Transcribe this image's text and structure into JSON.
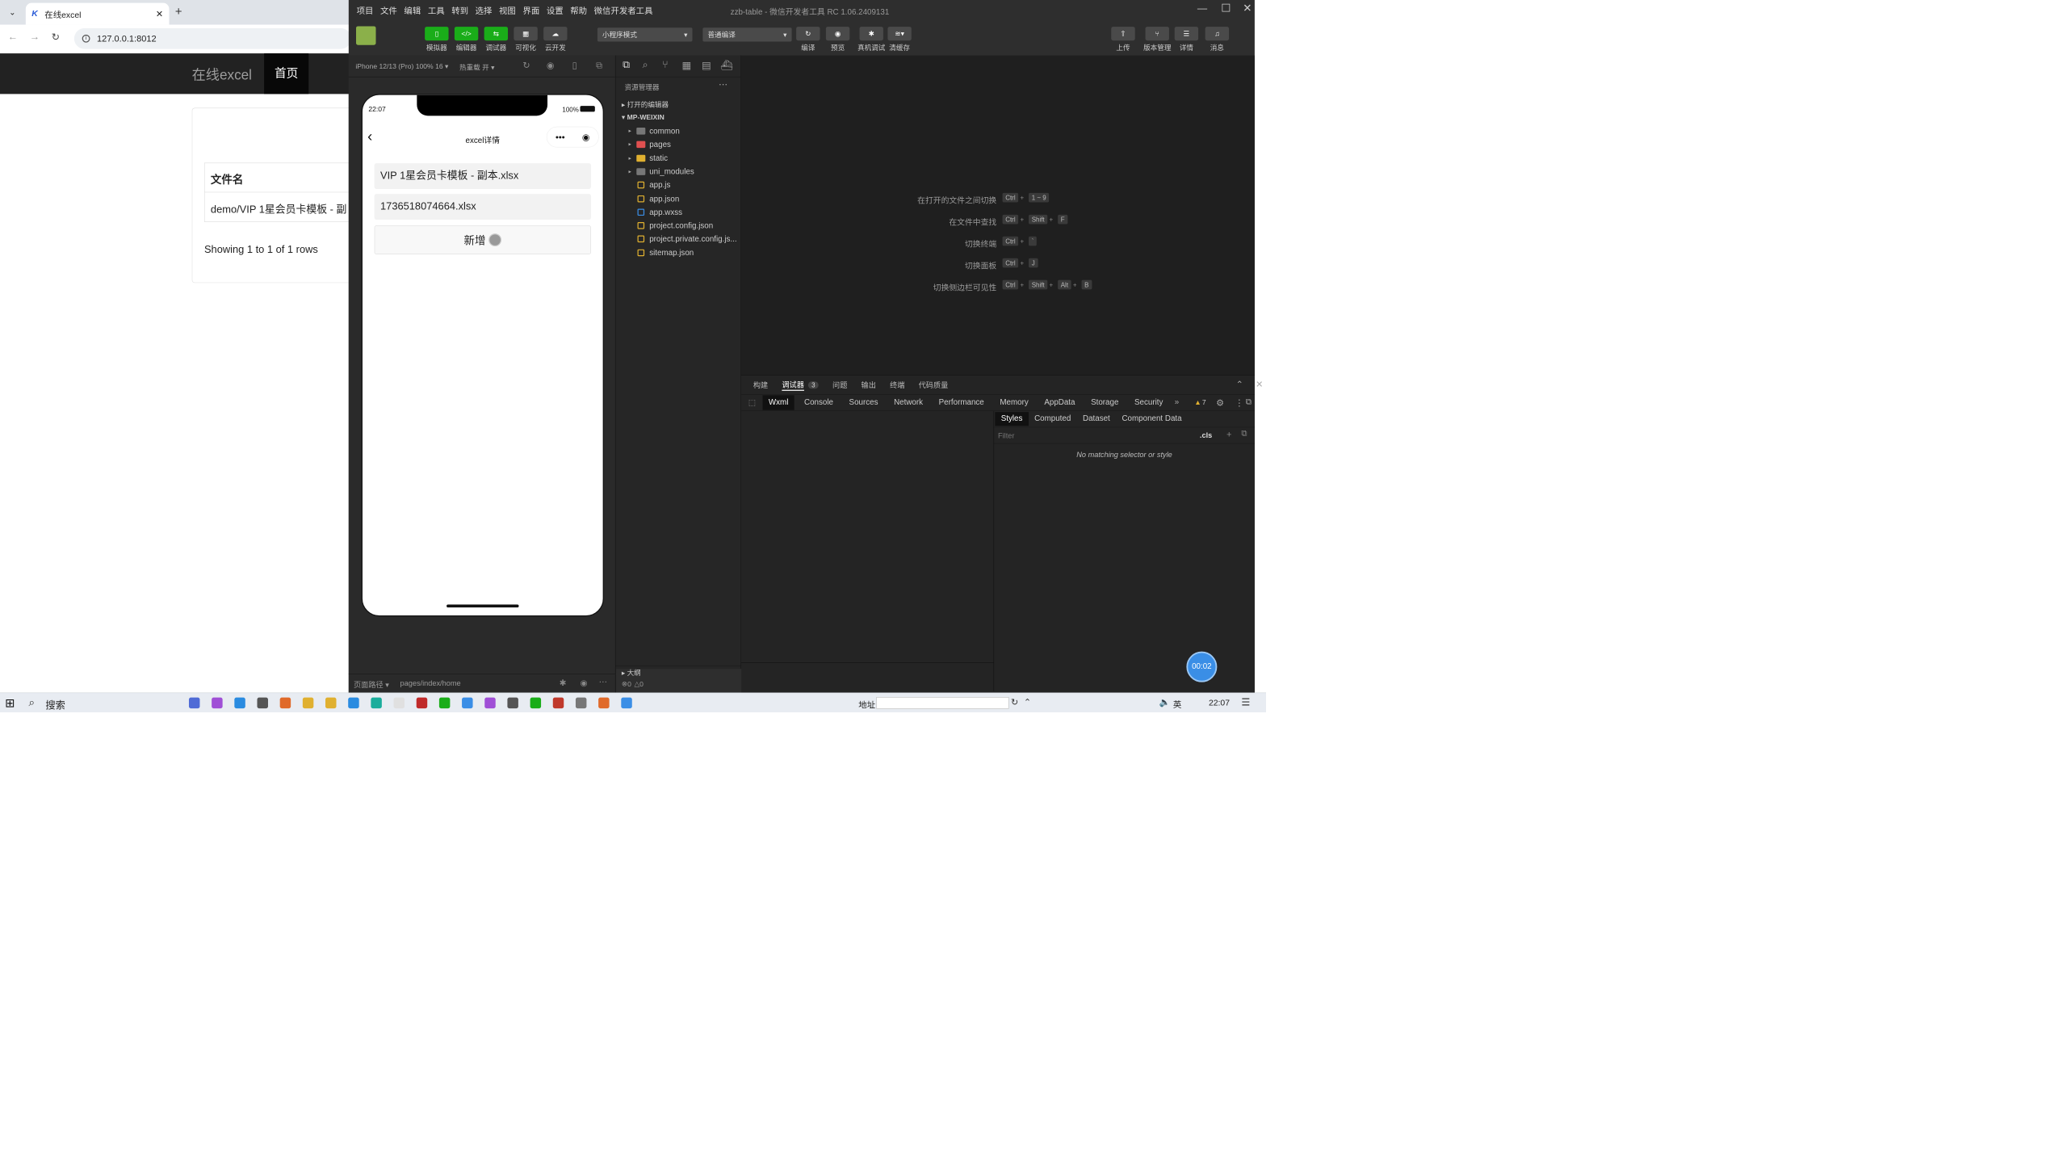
{
  "browser": {
    "tab_title": "在线excel",
    "url": "127.0.0.1:8012"
  },
  "site": {
    "brand": "在线excel",
    "nav_home": "首页",
    "table_header": "文件名",
    "row1": "demo/VIP 1星会员卡模板 - 副",
    "pagination": "Showing 1 to 1 of 1 rows"
  },
  "devtools": {
    "title": "zzb-table - 微信开发者工具 RC 1.06.2409131",
    "menu": [
      "项目",
      "文件",
      "编辑",
      "工具",
      "转到",
      "选择",
      "视图",
      "界面",
      "设置",
      "帮助",
      "微信开发者工具"
    ],
    "toolbar": {
      "simulator": "模拟器",
      "editor": "编辑器",
      "debugger": "调试器",
      "visual": "可视化",
      "cloud": "云开发",
      "mode": "小程序模式",
      "compile_mode": "普通编译",
      "compile": "编译",
      "preview": "预览",
      "real_debug": "真机调试",
      "clear_cache": "清缓存",
      "upload": "上传",
      "version": "版本管理",
      "details": "详情",
      "messages": "消息"
    },
    "device_label": "iPhone 12/13 (Pro) 100% 16 ▾",
    "hot_reload": "热重载 开 ▾",
    "phone": {
      "time": "22:07",
      "battery": "100%",
      "page_title": "excel详情",
      "file1": "VIP 1星会员卡模板 - 副本.xlsx",
      "file2": "1736518074664.xlsx",
      "add_button": "新增"
    },
    "status_bar": {
      "page_path_label": "页面路径 ▾",
      "page_path": "pages/index/home"
    },
    "explorer": {
      "title": "资源管理器",
      "open_editors": "打开的编辑器",
      "project": "MP-WEIXIN",
      "items": [
        {
          "name": "common",
          "type": "folder",
          "color": "#777"
        },
        {
          "name": "pages",
          "type": "folder",
          "color": "#e05050"
        },
        {
          "name": "static",
          "type": "folder",
          "color": "#e0b030"
        },
        {
          "name": "uni_modules",
          "type": "folder",
          "color": "#777"
        },
        {
          "name": "app.js",
          "type": "file",
          "color": "#e0b030"
        },
        {
          "name": "app.json",
          "type": "file",
          "color": "#e0b030"
        },
        {
          "name": "app.wxss",
          "type": "file",
          "color": "#3a8ee6"
        },
        {
          "name": "project.config.json",
          "type": "file",
          "color": "#e0b030"
        },
        {
          "name": "project.private.config.js...",
          "type": "file",
          "color": "#e0b030"
        },
        {
          "name": "sitemap.json",
          "type": "file",
          "color": "#e0b030"
        }
      ],
      "outline": "大纲",
      "errors": "0",
      "warnings": "0"
    },
    "shortcuts": [
      {
        "label": "在打开的文件之间切换",
        "keys": [
          "Ctrl",
          "1 ~ 9"
        ]
      },
      {
        "label": "在文件中查找",
        "keys": [
          "Ctrl",
          "Shift",
          "F"
        ]
      },
      {
        "label": "切换终端",
        "keys": [
          "Ctrl",
          "`"
        ]
      },
      {
        "label": "切换面板",
        "keys": [
          "Ctrl",
          "J"
        ]
      },
      {
        "label": "切换侧边栏可见性",
        "keys": [
          "Ctrl",
          "Shift",
          "Alt",
          "B"
        ]
      }
    ],
    "debug": {
      "top_tabs": [
        "构建",
        "调试器",
        "问题",
        "输出",
        "终端",
        "代码质量"
      ],
      "debugger_badge": "3",
      "panel_tabs": [
        "Wxml",
        "Console",
        "Sources",
        "Network",
        "Performance",
        "Memory",
        "AppData",
        "Storage",
        "Security"
      ],
      "warn_count": "7",
      "style_tabs": [
        "Styles",
        "Computed",
        "Dataset",
        "Component Data"
      ],
      "filter_placeholder": "Filter",
      "cls": ".cls",
      "no_match": "No matching selector or style",
      "timer": "00:02"
    }
  },
  "taskbar": {
    "search": "搜索",
    "address_label": "地址",
    "time": "22:07",
    "lang": "英"
  }
}
